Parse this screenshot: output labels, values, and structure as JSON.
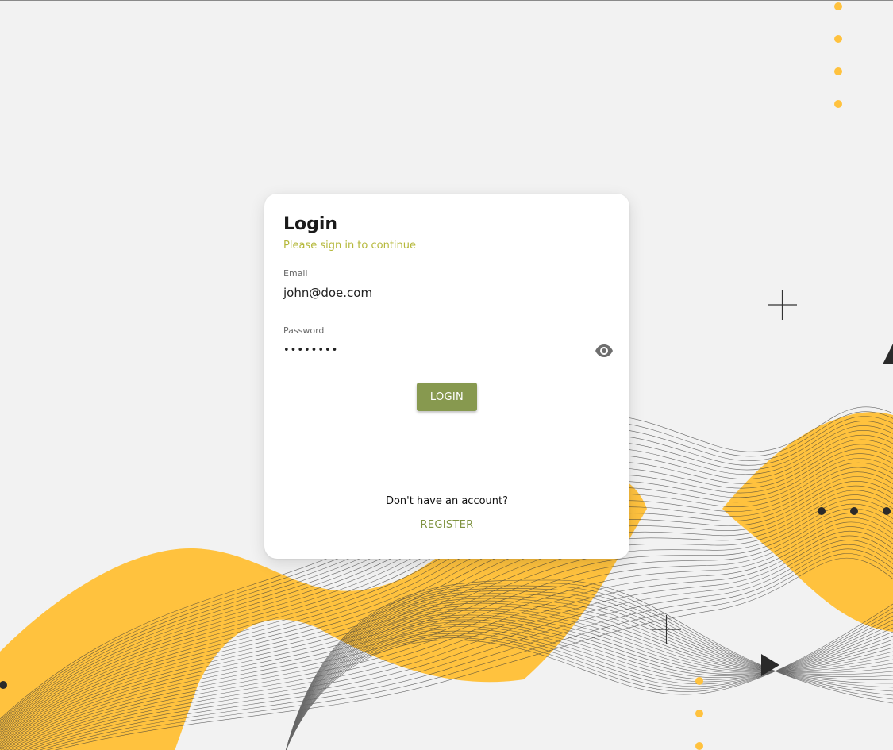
{
  "login": {
    "title": "Login",
    "subtitle": "Please sign in to continue",
    "email_label": "Email",
    "email_value": "john@doe.com",
    "password_label": "Password",
    "password_value": "secret12",
    "login_button": "LOGIN",
    "no_account_text": "Don't have an account?",
    "register_link": "REGISTER"
  },
  "icons": {
    "password_toggle": "eye-icon"
  },
  "colors": {
    "accent_green": "#87994f",
    "subtitle_yellow": "#b5b83b",
    "register_green": "#7f9341",
    "wave_orange": "#ffc23e"
  }
}
